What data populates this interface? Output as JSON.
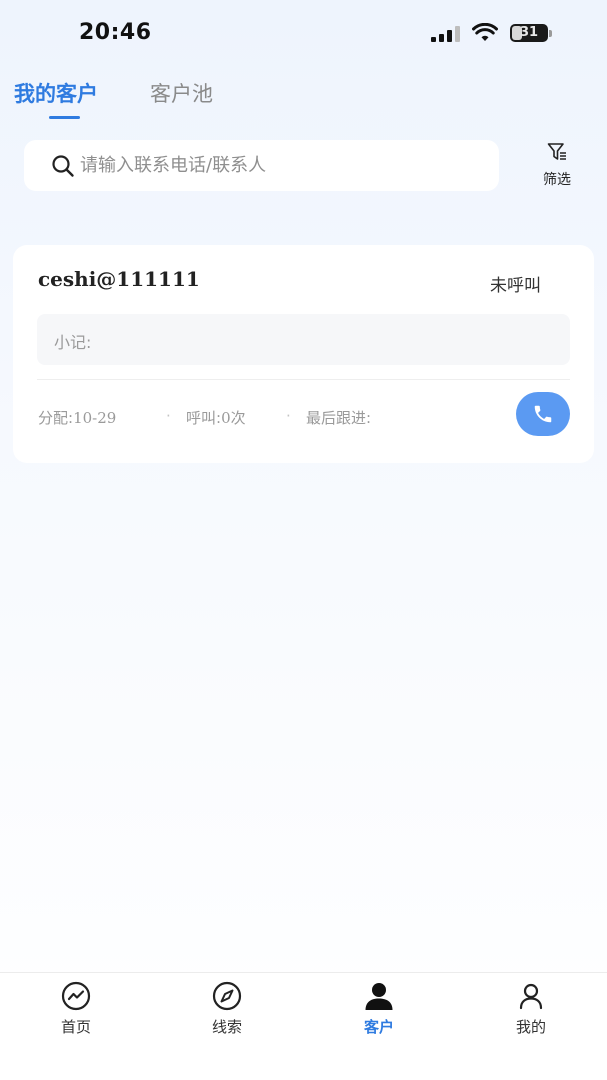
{
  "status_bar": {
    "time": "20:46",
    "battery_level": "31",
    "icons": [
      "signal-icon",
      "wifi-icon",
      "battery-icon"
    ]
  },
  "tabs": [
    {
      "label": "我的客户",
      "active": true
    },
    {
      "label": "客户池",
      "active": false
    }
  ],
  "search": {
    "placeholder": "请输入联系电话/联系人",
    "value": ""
  },
  "filter": {
    "label": "筛选",
    "icon": "filter-icon"
  },
  "customers": [
    {
      "name": "ceshi@111111",
      "call_status": "未呼叫",
      "note_label": "小记:",
      "assigned_label": "分配:",
      "assigned_value": "10-29",
      "calls_label": "呼叫:",
      "calls_value": "0次",
      "last_follow_label": "最后跟进:",
      "last_follow_value": "",
      "separator": "·",
      "call_icon": "phone-icon"
    }
  ],
  "bottom_nav": [
    {
      "label": "首页",
      "icon": "chart-line-icon",
      "active": false
    },
    {
      "label": "线索",
      "icon": "compass-icon",
      "active": false
    },
    {
      "label": "客户",
      "icon": "person-filled-icon",
      "active": true
    },
    {
      "label": "我的",
      "icon": "person-outline-icon",
      "active": false
    }
  ],
  "colors": {
    "accent": "#2f7be0",
    "call_button": "#5b9af2",
    "muted_text": "#9a9a9a"
  }
}
